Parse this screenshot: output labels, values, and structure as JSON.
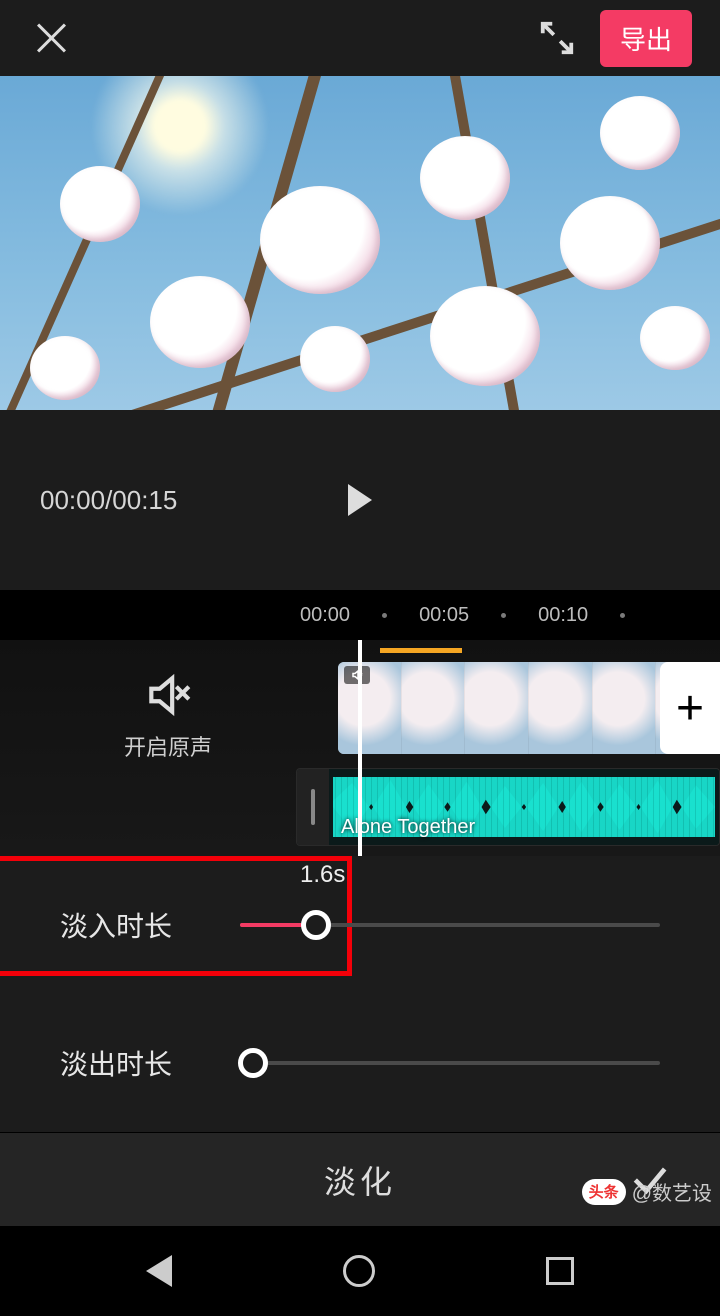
{
  "topbar": {
    "export_label": "导出"
  },
  "player": {
    "time_text": "00:00/00:15"
  },
  "timeline": {
    "marks": [
      "00:00",
      "00:05",
      "00:10"
    ],
    "mute_label": "开启原声",
    "audio_name": "Alone Together",
    "add_symbol": "+"
  },
  "sliders": {
    "fade_in": {
      "label": "淡入时长",
      "value_text": "1.6s",
      "value_pct": 18
    },
    "fade_out": {
      "label": "淡出时长",
      "value_pct": 3
    }
  },
  "confirm": {
    "title": "淡化"
  },
  "watermark": {
    "bubble": "头条",
    "at": "@数艺设"
  },
  "colors": {
    "accent": "#f43b64",
    "highlight": "#f30009"
  }
}
